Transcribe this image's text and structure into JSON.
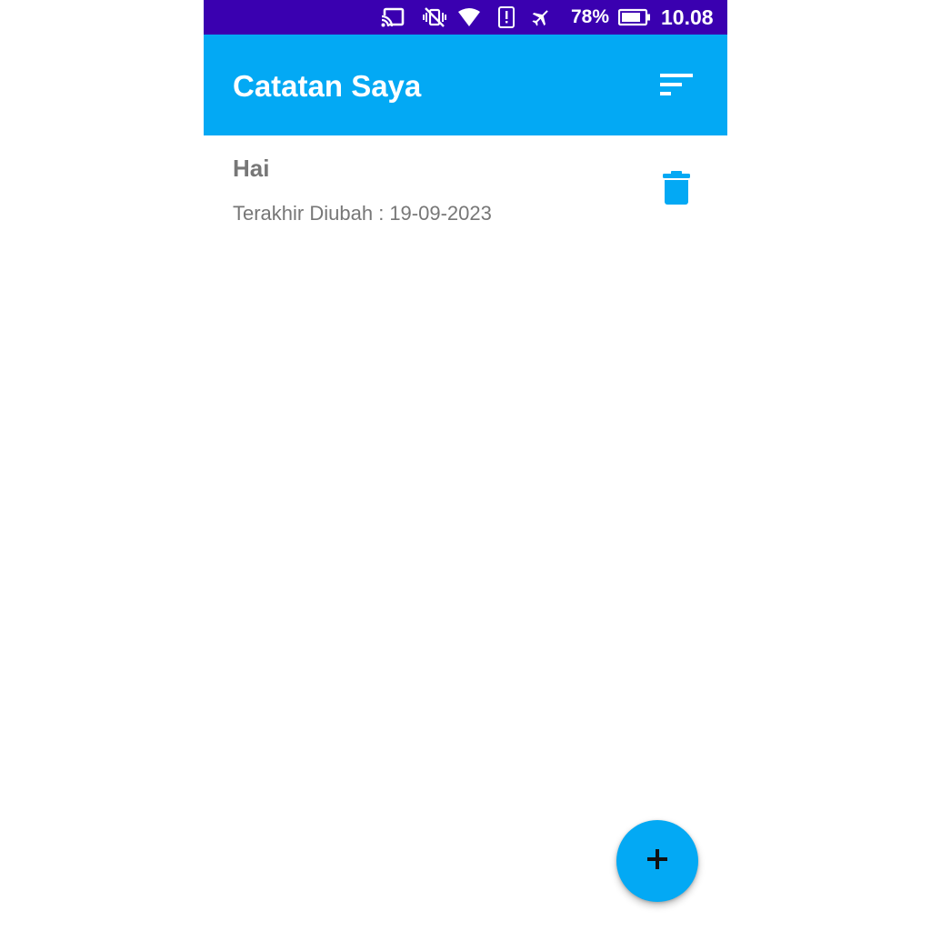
{
  "status_bar": {
    "icons": [
      "cast-icon",
      "vibrate-off-icon",
      "wifi-icon",
      "alert-icon",
      "airplane-icon",
      "battery-icon"
    ],
    "battery_percent": "78%",
    "time": "10.08",
    "background_color": "#3a00b0"
  },
  "app_bar": {
    "title": "Catatan Saya",
    "sort_icon": "sort-icon",
    "background_color": "#03a9f4"
  },
  "notes": [
    {
      "title": "Hai",
      "modified_label": "Terakhir Diubah :",
      "modified_date": "19-09-2023",
      "delete_icon": "trash-icon"
    }
  ],
  "fab": {
    "icon": "plus-icon",
    "label": "+",
    "background_color": "#03a9f4"
  }
}
